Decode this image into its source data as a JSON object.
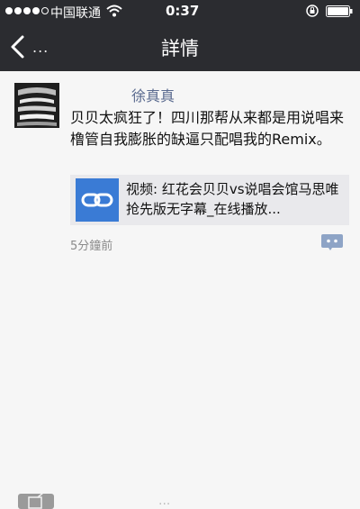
{
  "status_bar": {
    "carrier": "中国联通",
    "time": "0:37",
    "signal_icon": "signal-dots",
    "wifi_icon": "wifi-icon",
    "lock_icon": "orientation-lock-icon",
    "battery_icon": "battery-icon"
  },
  "nav": {
    "back_label": "...",
    "title": "詳情"
  },
  "post": {
    "author": "徐真真",
    "text": "贝贝太疯狂了！四川那帮从来都是用说唱来橹管自我膨胀的缺逼只配唱我的Remix。",
    "link_card": {
      "title": "视频: 红花会贝贝vs说唱会馆马思唯 抢先版无字幕_在线播放...",
      "icon": "link-icon"
    },
    "timestamp": "5分鐘前",
    "comment_icon": "comment-icon"
  },
  "bottom": {
    "compose_icon": "compose-icon",
    "faint_text": "..."
  },
  "colors": {
    "header_bg": "#2b2c30",
    "page_bg": "#f6f6f6",
    "author": "#5a6a8f",
    "link_card_bg": "#e9e9ec",
    "link_thumb": "#3a7bd5"
  }
}
